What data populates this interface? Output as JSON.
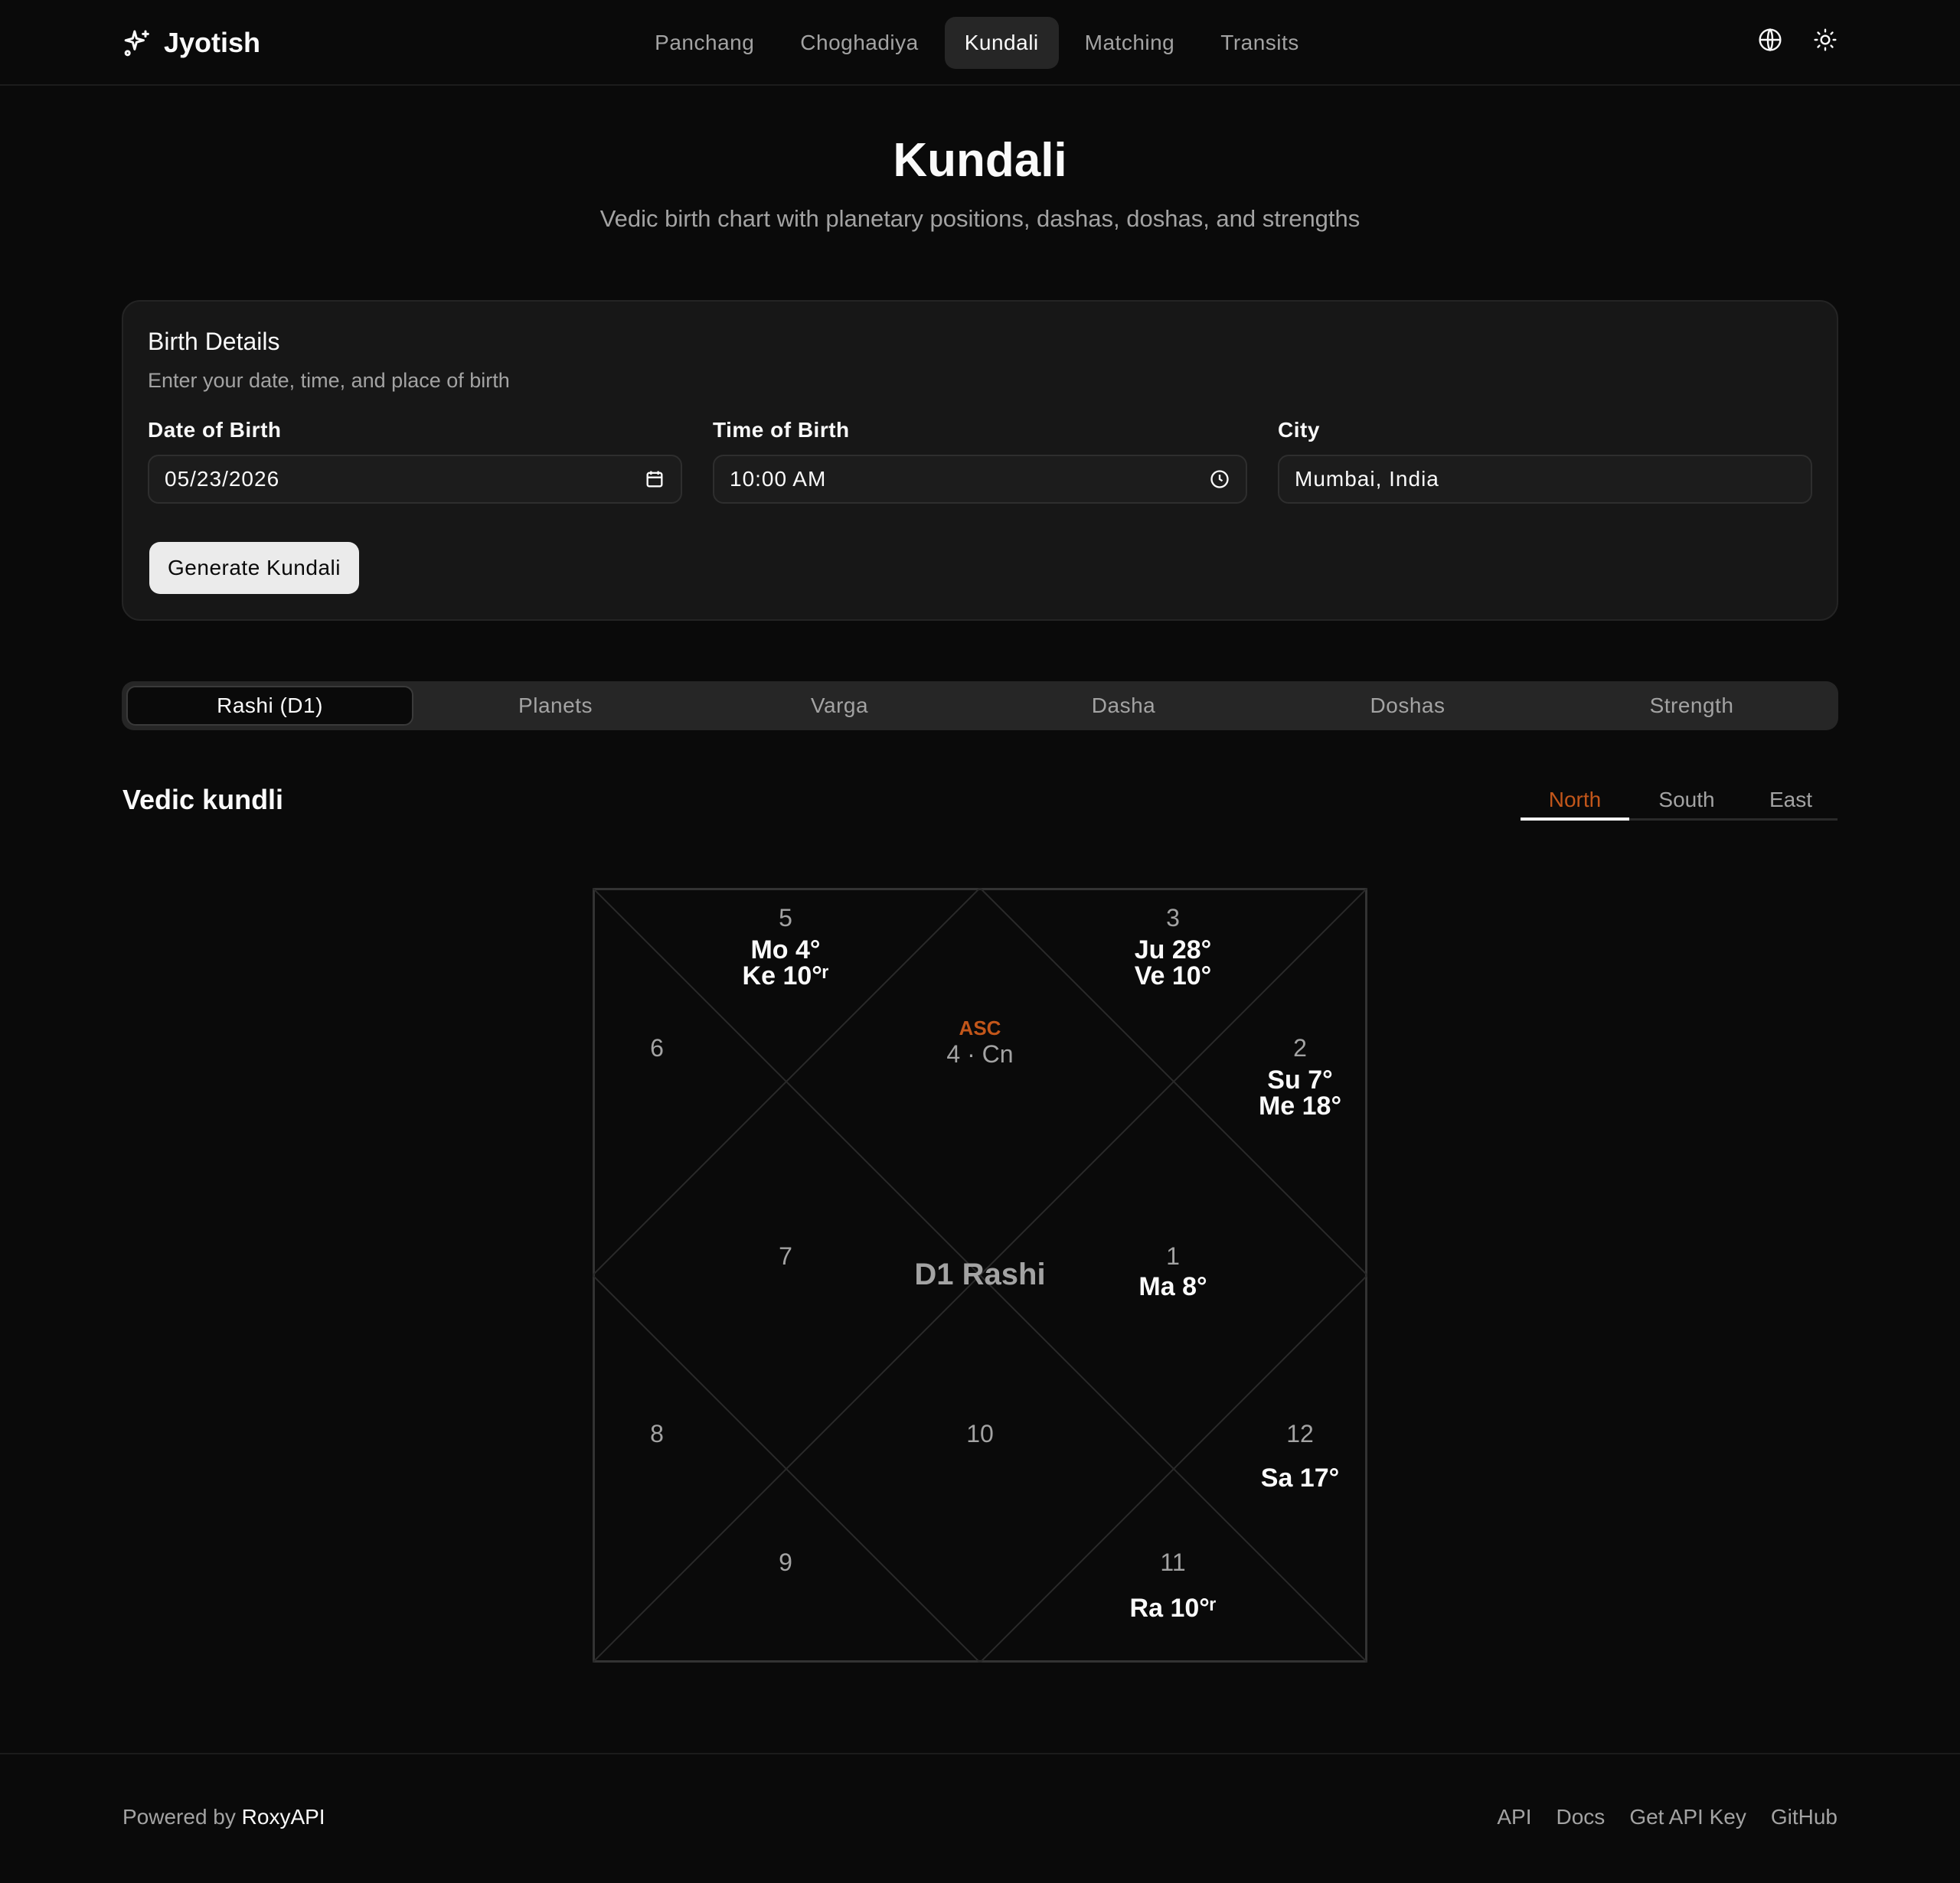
{
  "header": {
    "brand": "Jyotish",
    "nav": [
      "Panchang",
      "Choghadiya",
      "Kundali",
      "Matching",
      "Transits"
    ],
    "active_nav": 2
  },
  "hero": {
    "title": "Kundali",
    "subtitle": "Vedic birth chart with planetary positions, dashas, doshas, and strengths"
  },
  "birth_card": {
    "title": "Birth Details",
    "subtitle": "Enter your date, time, and place of birth",
    "date_label": "Date of Birth",
    "date_value": "05/23/2026",
    "time_label": "Time of Birth",
    "time_value": "10:00 AM",
    "city_label": "City",
    "city_value": "Mumbai, India",
    "button": "Generate Kundali"
  },
  "tabs": [
    "Rashi (D1)",
    "Planets",
    "Varga",
    "Dasha",
    "Doshas",
    "Strength"
  ],
  "active_tab": 0,
  "section": {
    "title": "Vedic kundli",
    "styles": [
      "North",
      "South",
      "East"
    ],
    "active_style": 0
  },
  "chart_data": {
    "type": "table",
    "center_label": "D1 Rashi",
    "asc_label": "ASC",
    "asc_sign": "4 · Cn",
    "houses": [
      {
        "house": "1",
        "planets": [
          "Ma 8°"
        ]
      },
      {
        "house": "2",
        "planets": [
          "Su 7°",
          "Me 18°"
        ]
      },
      {
        "house": "3",
        "planets": [
          "Ju 28°",
          "Ve 10°"
        ]
      },
      {
        "house": "4",
        "planets": []
      },
      {
        "house": "5",
        "planets": [
          "Mo 4°",
          "Ke 10°ʳ"
        ]
      },
      {
        "house": "6",
        "planets": []
      },
      {
        "house": "7",
        "planets": []
      },
      {
        "house": "8",
        "planets": []
      },
      {
        "house": "9",
        "planets": []
      },
      {
        "house": "10",
        "planets": []
      },
      {
        "house": "11",
        "planets": [
          "Ra 10°ʳ"
        ]
      },
      {
        "house": "12",
        "planets": [
          "Sa 17°"
        ]
      }
    ]
  },
  "footer": {
    "powered_prefix": "Powered by",
    "powered_brand": "RoxyAPI",
    "links": [
      "API",
      "Docs",
      "Get API Key",
      "GitHub"
    ]
  },
  "colors": {
    "accent": "#c2561a",
    "background": "#0a0a0a",
    "card": "#171717",
    "muted": "#a3a3a3"
  }
}
